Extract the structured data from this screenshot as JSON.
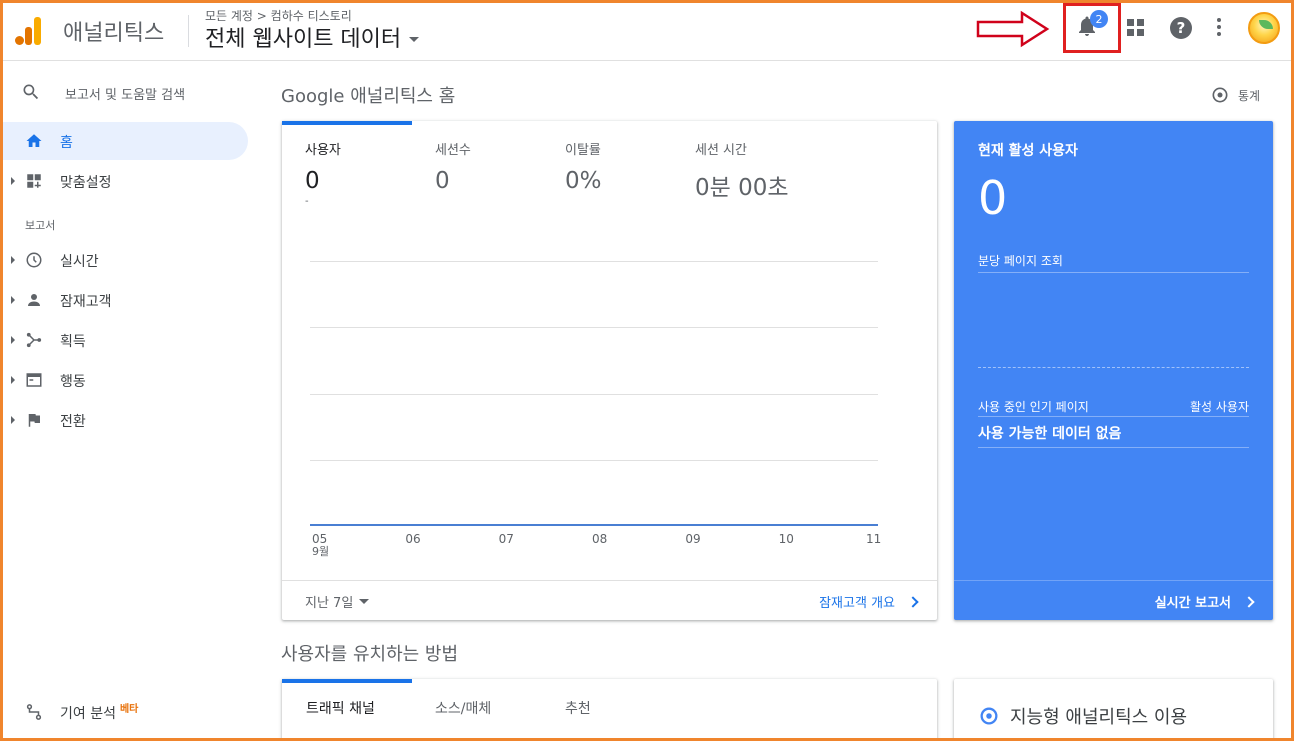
{
  "header": {
    "brand": "애널리틱스",
    "breadcrumb": "모든 계정 > 컴하수 티스토리",
    "view_title": "전체 웹사이트 데이터",
    "notification_count": "2"
  },
  "sidebar": {
    "search_placeholder": "보고서 및 도움말 검색",
    "items": [
      {
        "label": "홈",
        "icon": "home-icon"
      },
      {
        "label": "맞춤설정",
        "icon": "dashboard-icon"
      }
    ],
    "reports_label": "보고서",
    "reports": [
      {
        "label": "실시간",
        "icon": "clock-icon"
      },
      {
        "label": "잠재고객",
        "icon": "person-icon"
      },
      {
        "label": "획득",
        "icon": "acquisition-icon"
      },
      {
        "label": "행동",
        "icon": "behavior-icon"
      },
      {
        "label": "전환",
        "icon": "flag-icon"
      }
    ],
    "attribution_label": "기여 분석",
    "attribution_badge": "베타"
  },
  "main": {
    "title": "Google 애널리틱스 홈",
    "insights_label": "통계",
    "metrics": [
      {
        "label": "사용자",
        "value": "0"
      },
      {
        "label": "세션수",
        "value": "0"
      },
      {
        "label": "이탈률",
        "value": "0%"
      },
      {
        "label": "세션 시간",
        "value": "0분 00초"
      }
    ],
    "chart_small_mark": "-",
    "x_ticks": [
      "05",
      "06",
      "07",
      "08",
      "09",
      "10",
      "11"
    ],
    "x_month": "9월",
    "date_range": "지난 7일",
    "audience_link": "잠재고객 개요"
  },
  "realtime": {
    "title": "현재 활성 사용자",
    "value": "0",
    "pageviews_label": "분당 페이지 조회",
    "top_pages_label": "사용 중인 인기 페이지",
    "active_users_label": "활성 사용자",
    "no_data": "사용 가능한 데이터 없음",
    "report_link": "실시간 보고서"
  },
  "acquisition": {
    "title": "사용자를 유치하는 방법",
    "tabs": [
      "트래픽 채널",
      "소스/매체",
      "추천"
    ]
  },
  "intelligence": {
    "label": "지능형 애널리틱스 이용"
  },
  "chart_data": {
    "type": "line",
    "x": [
      "05",
      "06",
      "07",
      "08",
      "09",
      "10",
      "11"
    ],
    "series": [
      {
        "values": [
          0,
          0,
          0,
          0,
          0,
          0,
          0
        ]
      }
    ],
    "xlabel": "9월"
  }
}
